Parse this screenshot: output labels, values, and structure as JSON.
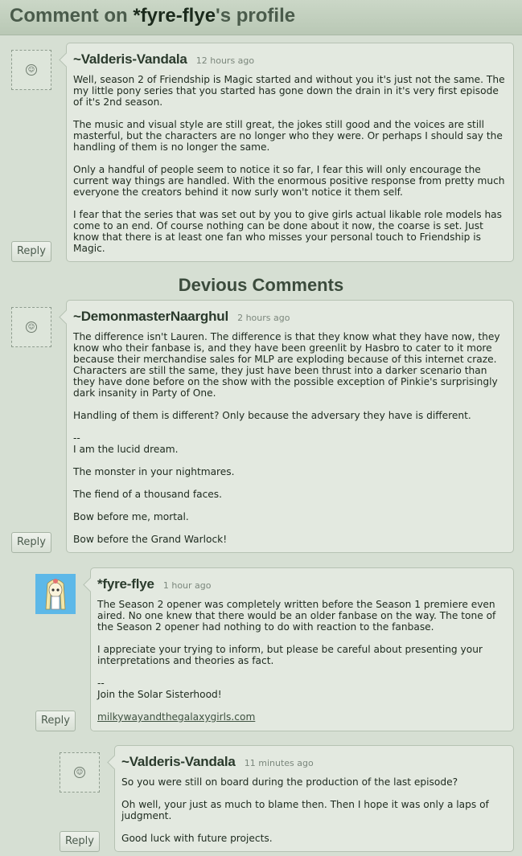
{
  "header": {
    "prefix": "Comment on ",
    "username": "*fyre-flye",
    "suffix": "'s profile"
  },
  "section_title": "Devious Comments",
  "reply_label": "Reply",
  "comments": [
    {
      "author": "~Valderis-Vandala",
      "time": "12 hours ago",
      "paragraphs": [
        "Well, season 2 of Friendship is Magic started and without you it's just not the same. The my little pony series that you started has gone down the drain in it's very first episode of it's 2nd season.",
        "The music and visual style are still great, the jokes still good and the voices are still masterful, but the characters are no longer who they were. Or perhaps I should say the handling of them is no longer the same.",
        "Only a handful of people seem to notice it so far, I fear this will only encourage the current way things are handled. With the enormous positive response from pretty much everyone the creators behind it now surly won't notice it them self.",
        "I fear that the series that was set out by you to give girls actual likable role models has come to an end. Of course nothing can be done about it now, the coarse is set. Just know that there is at least one fan who misses your personal touch to Friendship is Magic."
      ]
    },
    {
      "author": "~DemonmasterNaarghul",
      "time": "2 hours ago",
      "paragraphs": [
        "The difference isn't Lauren. The difference is that they know what they have now, they know who their fanbase is, and they have been greenlit by Hasbro to cater to it more because their merchandise sales for MLP are exploding because of this internet craze. Characters are still the same, they just have been thrust into a darker scenario than they have done before on the show with the possible exception of Pinkie's surprisingly dark insanity in Party of One.",
        "Handling of them is different? Only because the adversary they have is different.",
        "--\nI am the lucid dream.",
        "The monster in your nightmares.",
        "The fiend of a thousand faces.",
        "Bow before me, mortal.",
        "Bow before the Grand Warlock!"
      ]
    },
    {
      "author": "*fyre-flye",
      "time": "1 hour ago",
      "paragraphs": [
        "The Season 2 opener was completely written before the Season 1 premiere even aired. No one knew that there would be an older fanbase on the way. The tone of the Season 2 opener had nothing to do with reaction to the fanbase.",
        "I appreciate your trying to inform, but please be careful about presenting your interpretations and theories as fact.",
        "--\nJoin the Solar Sisterhood!"
      ],
      "link": "milkywayandthegalaxygirls.com"
    },
    {
      "author": "~Valderis-Vandala",
      "time": "11 minutes ago",
      "paragraphs": [
        "So you were still on board during the production of the last episode?",
        "Oh well, your just as much to blame then. Then I hope it was only a laps of judgment.",
        "Good luck with future projects."
      ]
    }
  ]
}
